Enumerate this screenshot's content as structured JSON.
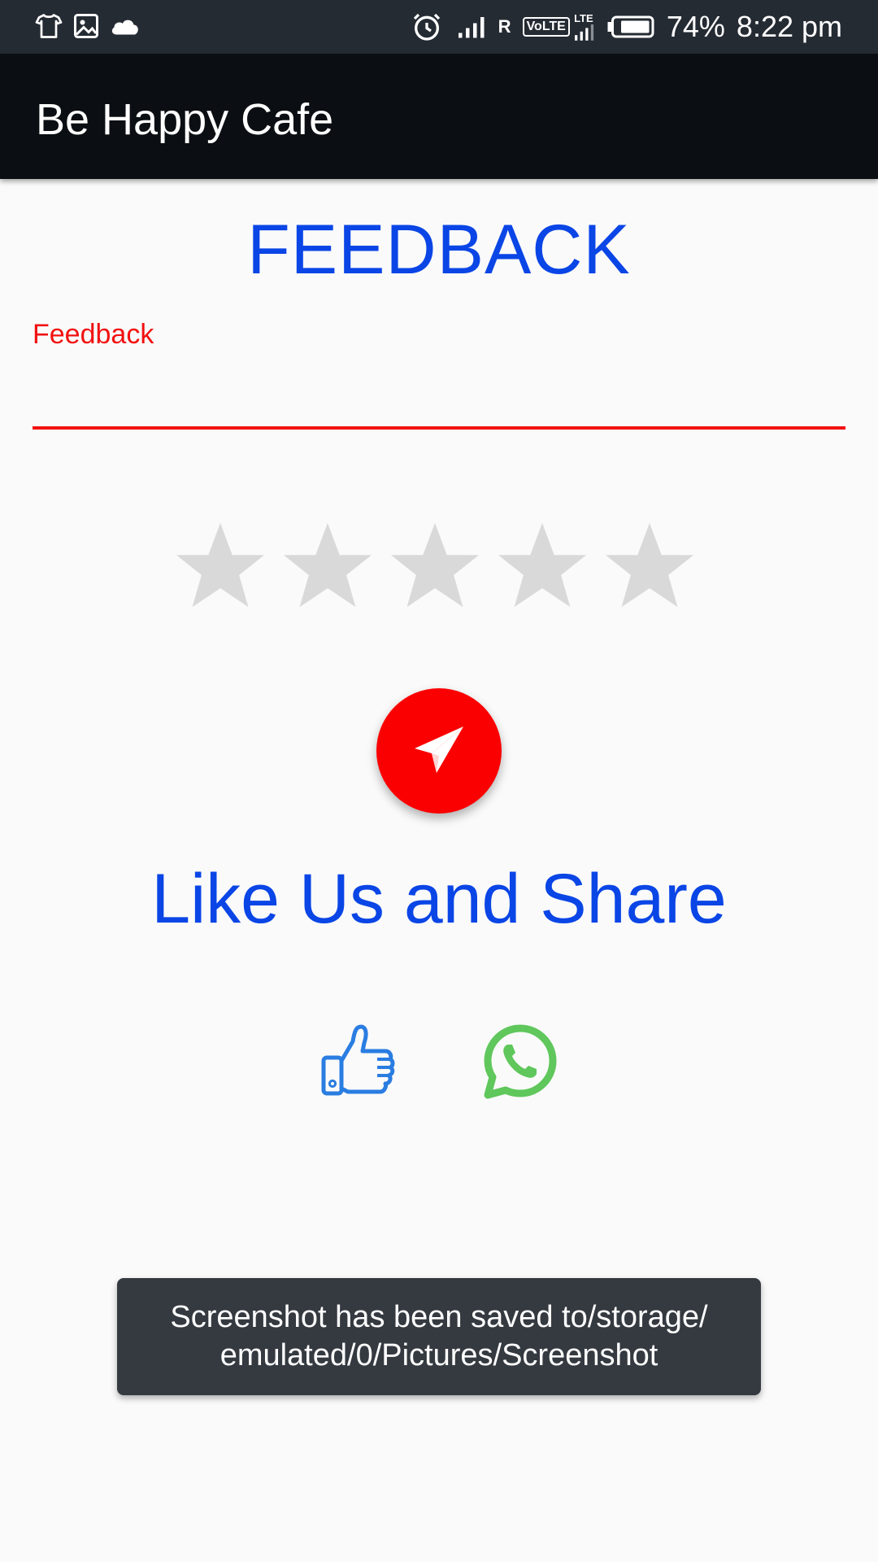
{
  "status_bar": {
    "battery_percent": "74%",
    "time": "8:22 pm",
    "roaming_mark": "R",
    "volte_label": "VoLTE",
    "lte_label": "LTE",
    "left_icons": [
      "shirt-icon",
      "image-icon",
      "cloud-icon"
    ],
    "right_icons": [
      "alarm-icon",
      "signal-icon",
      "volte-icon",
      "battery-icon"
    ]
  },
  "app_bar": {
    "title": "Be Happy Cafe"
  },
  "main": {
    "title": "FEEDBACK",
    "feedback_label": "Feedback",
    "feedback_value": "",
    "rating": {
      "value": 0,
      "max": 5,
      "star_color": "#d9d9d9"
    },
    "send_icon": "paper-plane-icon",
    "share_heading": "Like Us and Share",
    "share_icons": [
      "thumbs-up-icon",
      "whatsapp-icon"
    ]
  },
  "toast": {
    "message": "Screenshot has been saved to/storage/ emulated/0/Pictures/Screenshot"
  },
  "colors": {
    "accent_blue": "#0a45e6",
    "error_red": "#f21111",
    "fab_red": "#fb0000",
    "status_bar": "#252b33",
    "app_bar": "#0b0e12",
    "toast_bg": "#353a41",
    "whatsapp_green": "#5fc75b",
    "like_blue": "#2a7de1"
  }
}
